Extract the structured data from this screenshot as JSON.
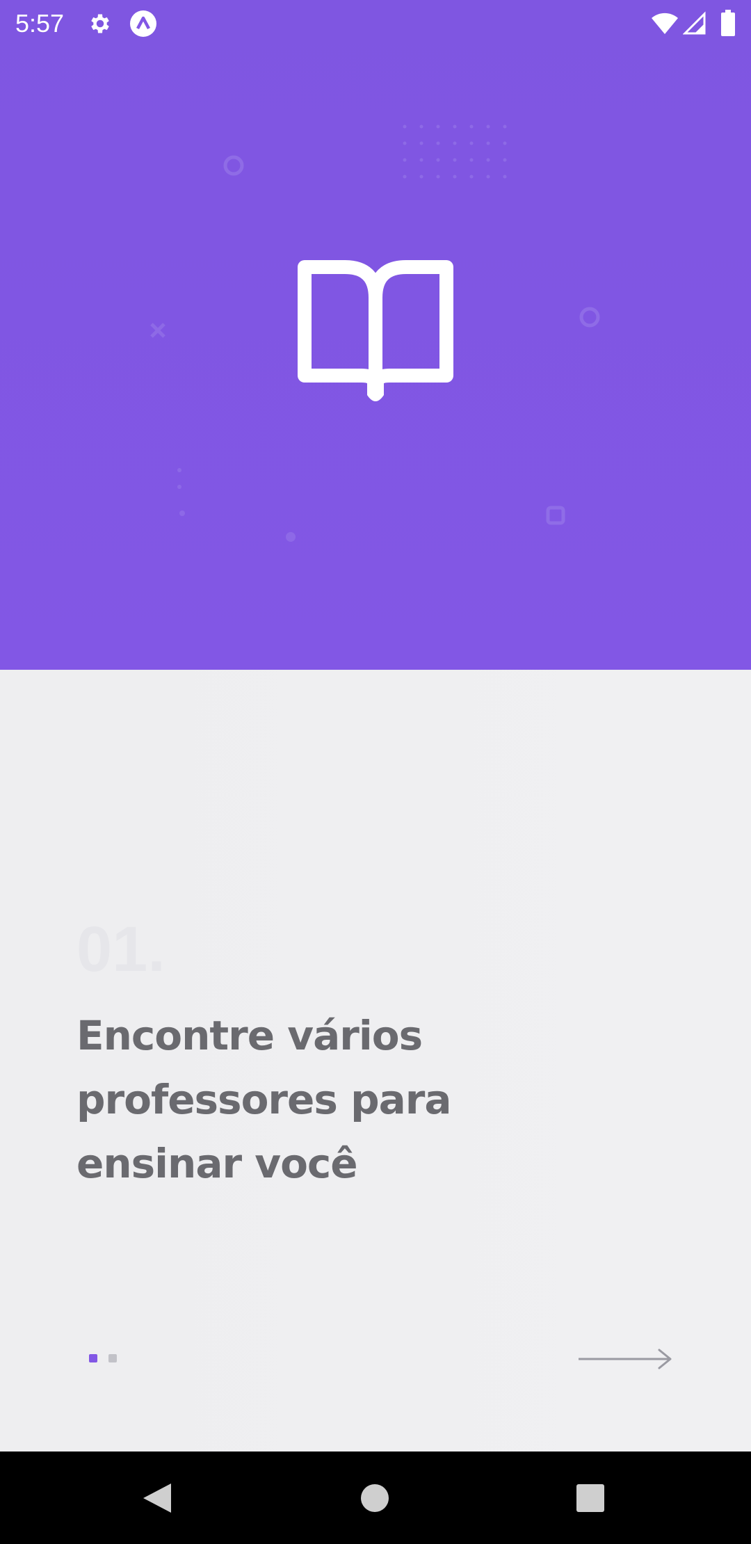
{
  "status_bar": {
    "time": "5:57",
    "icons": [
      "gear-icon",
      "app-notification-icon",
      "wifi-icon",
      "signal-icon",
      "battery-icon"
    ]
  },
  "hero": {
    "background_color": "#8257e5",
    "icon": "open-book-icon"
  },
  "onboarding": {
    "step_number": "01.",
    "headline": "Encontre vários professores para ensinar você",
    "page_count": 2,
    "active_page": 1,
    "next_icon": "arrow-right-icon"
  },
  "colors": {
    "accent": "#8257e5",
    "headline": "#6a6a6f",
    "step_number": "#e6e6ea",
    "inactive_dot": "#c2c2c8"
  },
  "nav_bar": {
    "buttons": [
      "back-icon",
      "home-icon",
      "recents-icon"
    ]
  }
}
